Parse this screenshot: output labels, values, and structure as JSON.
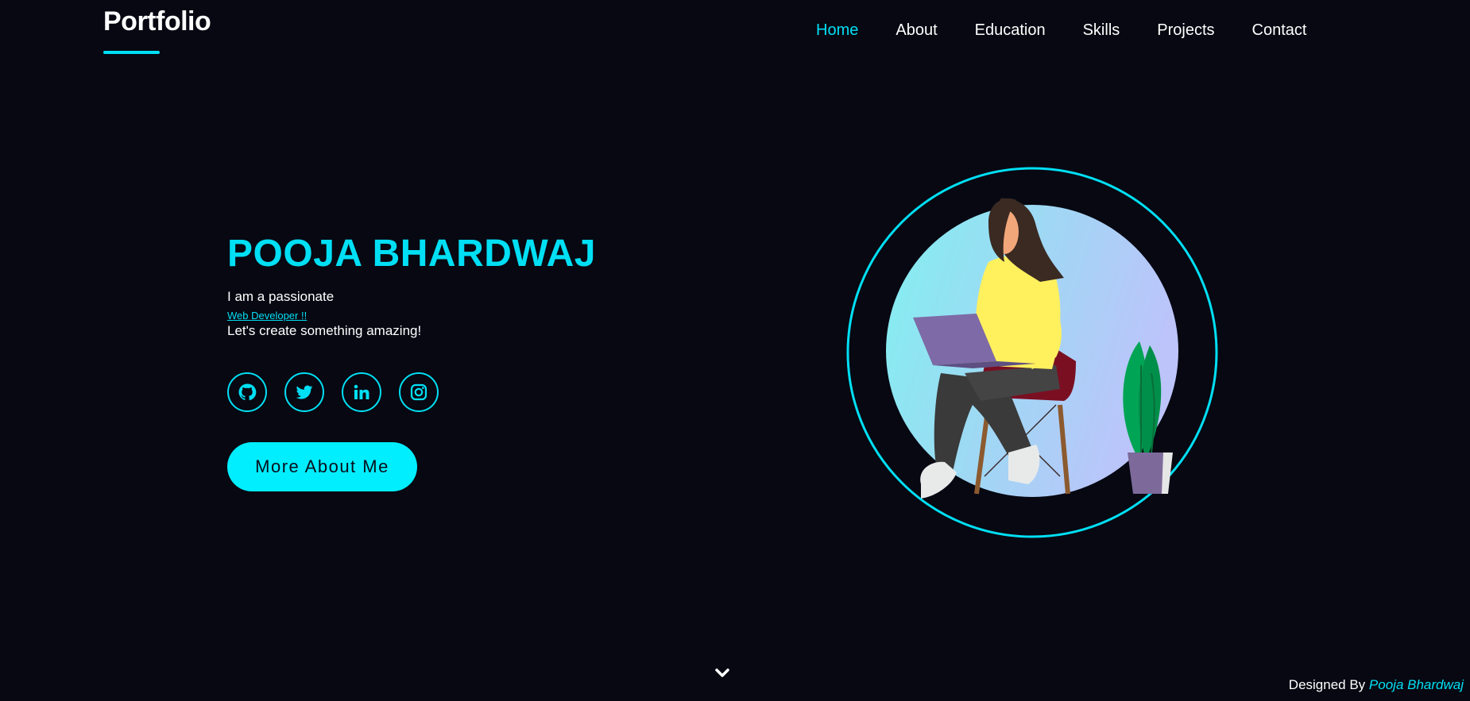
{
  "header": {
    "logo": "Portfolio",
    "nav": [
      {
        "label": "Home",
        "active": true
      },
      {
        "label": "About",
        "active": false
      },
      {
        "label": "Education",
        "active": false
      },
      {
        "label": "Skills",
        "active": false
      },
      {
        "label": "Projects",
        "active": false
      },
      {
        "label": "Contact",
        "active": false
      }
    ]
  },
  "hero": {
    "name": "POOJA BHARDWAJ",
    "tagline": "I am a passionate",
    "role": "Web Developer !!",
    "cta_line": "Let's create something amazing!",
    "socials": [
      {
        "icon": "github-icon"
      },
      {
        "icon": "twitter-icon"
      },
      {
        "icon": "linkedin-icon"
      },
      {
        "icon": "instagram-icon"
      }
    ],
    "button_label": "More About Me"
  },
  "footer": {
    "prefix": "Designed By",
    "author": "Pooja Bhardwaj"
  },
  "colors": {
    "background": "#070812",
    "accent": "#00dff4",
    "button": "#00eefe"
  }
}
